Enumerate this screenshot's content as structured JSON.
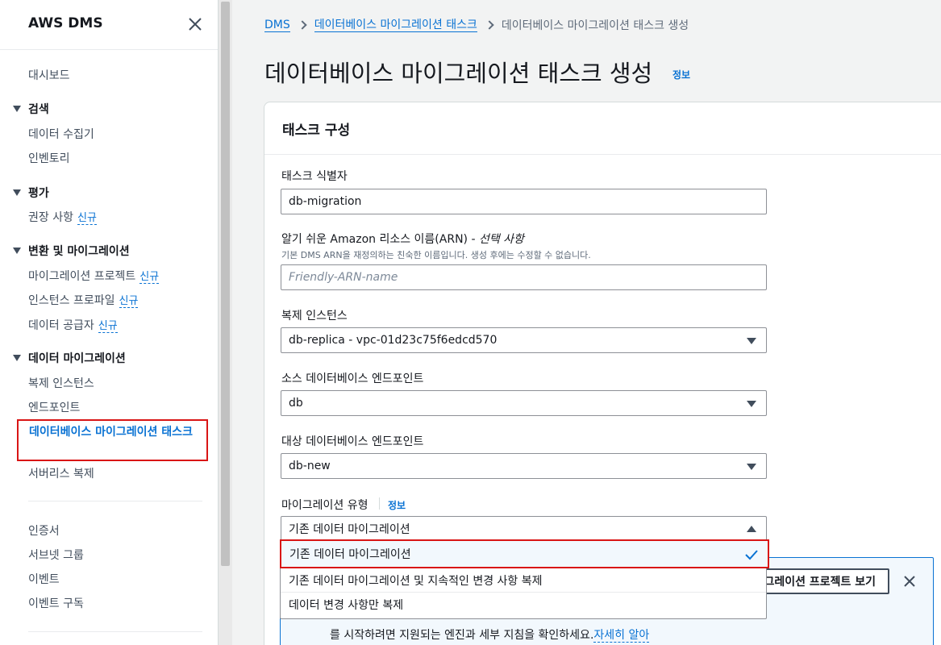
{
  "sidebar": {
    "title": "AWS DMS",
    "dashboard": "대시보드",
    "new_badge": "신규",
    "sections": {
      "search": {
        "label": "검색",
        "items": [
          "데이터 수집기",
          "인벤토리"
        ]
      },
      "assess": {
        "label": "평가",
        "items": [
          "권장 사항"
        ]
      },
      "convert": {
        "label": "변환 및 마이그레이션",
        "items": [
          "마이그레이션 프로젝트",
          "인스턴스 프로파일",
          "데이터 공급자"
        ]
      },
      "migrate": {
        "label": "데이터 마이그레이션",
        "items": [
          "복제 인스턴스",
          "엔드포인트",
          "데이터베이스 마이그레이션 태스크",
          "서버리스 복제"
        ]
      }
    },
    "bottom_items": [
      "인증서",
      "서브넷 그룹",
      "이벤트",
      "이벤트 구독"
    ]
  },
  "breadcrumb": {
    "root": "DMS",
    "parent": "데이터베이스 마이그레이션 태스크",
    "current": "데이터베이스 마이그레이션 태스크 생성"
  },
  "page": {
    "title": "데이터베이스 마이그레이션 태스크 생성",
    "info_label": "정보"
  },
  "panel": {
    "title": "태스크 구성"
  },
  "form": {
    "task_id": {
      "label": "태스크 식별자",
      "value": "db-migration"
    },
    "arn": {
      "label": "알기 쉬운 Amazon 리소스 이름(ARN) - ",
      "optional": "선택 사항",
      "description": "기본 DMS ARN을 재정의하는 친숙한 이름입니다. 생성 후에는 수정할 수 없습니다.",
      "placeholder": "Friendly-ARN-name"
    },
    "replication_instance": {
      "label": "복제 인스턴스",
      "value": "db-replica - vpc-01d23c75f6edcd570"
    },
    "source_endpoint": {
      "label": "소스 데이터베이스 엔드포인트",
      "value": "db"
    },
    "target_endpoint": {
      "label": "대상 데이터베이스 엔드포인트",
      "value": "db-new"
    },
    "migration_type": {
      "label": "마이그레이션 유형",
      "info_label": "정보",
      "value": "기존 데이터 마이그레이션",
      "options": [
        "기존 데이터 마이그레이션",
        "기존 데이터 마이그레이션 및 지속적인 변경 사항 복제",
        "데이터 변경 사항만 복제"
      ]
    }
  },
  "flash": {
    "button_label": "마이그레이션 프로젝트 보기",
    "text_line": "를 시작하려면 지원되는 엔진과 세부 지침을 확인하세요.",
    "link": "자세히 알아"
  },
  "colors": {
    "link": "#0972d3",
    "highlight_border": "#d91515",
    "selected_bg": "#f2f8fd"
  }
}
